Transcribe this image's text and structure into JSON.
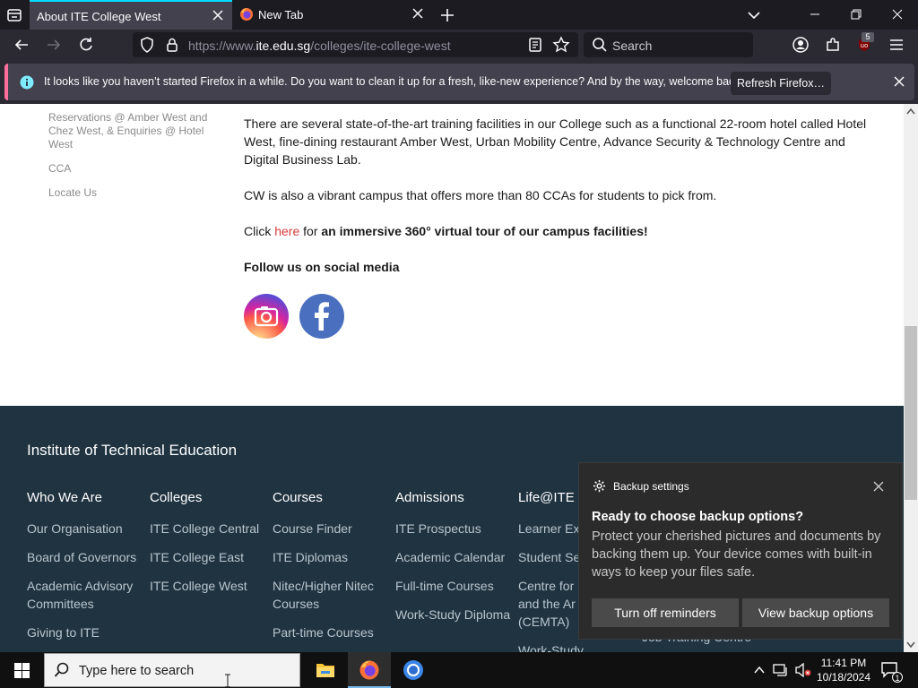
{
  "browser": {
    "tabs": [
      {
        "title": "About ITE College West"
      },
      {
        "title": "New Tab"
      }
    ],
    "url": {
      "prefix": "https://www.",
      "host": "ite.edu.sg",
      "path": "/colleges/ite-college-west"
    },
    "search_placeholder": "Search",
    "extension_badge": "5",
    "notification": {
      "text": "It looks like you haven’t started Firefox in a while. Do you want to clean it up for a fresh, like-new experience? And by the way, welcome back!",
      "button": "Refresh Firefox…"
    }
  },
  "sidebar": {
    "items": [
      {
        "label": "Reservations @ Amber West and Chez West, & Enquiries @ Hotel West"
      },
      {
        "label": "CCA"
      },
      {
        "label": "Locate Us"
      }
    ]
  },
  "main": {
    "paragraph1": "There are several state-of-the-art training facilities in our College such as a functional 22-room hotel called Hotel West, fine-dining restaurant Amber West, Urban Mobility Centre, Advance Security & Technology Centre and Digital Business Lab.",
    "paragraph2": "CW is also a vibrant campus that offers more than 80 CCAs for students to pick from.",
    "tour": {
      "prefix": "Click ",
      "link": "here",
      "middle": " for ",
      "bold": "an immersive 360° virtual tour of our campus facilities!"
    },
    "social_heading": "Follow us on social media"
  },
  "footer": {
    "title": "Institute of Technical Education",
    "columns": [
      {
        "heading": "Who We Are",
        "items": [
          "Our Organisation",
          "Board of Governors",
          "Academic Advisory Committees",
          "Giving to ITE"
        ]
      },
      {
        "heading": "Colleges",
        "items": [
          "ITE College Central",
          "ITE College East",
          "ITE College West"
        ]
      },
      {
        "heading": "Courses",
        "items": [
          "Course Finder",
          "ITE Diplomas",
          "Nitec/Higher Nitec Courses",
          "Part-time Courses"
        ]
      },
      {
        "heading": "Admissions",
        "items": [
          "ITE Prospectus",
          "Academic Calendar",
          "Full-time Courses",
          "Work-Study Diploma"
        ]
      },
      {
        "heading": "Life@ITE",
        "items": [
          "Learner Ex",
          "Student Se",
          "Centre for and the Ar (CEMTA)",
          "Work-Study"
        ]
      }
    ],
    "extra_item": "Job Training Centre"
  },
  "toast": {
    "app_name": "Backup settings",
    "title": "Ready to choose backup options?",
    "body": "Protect your cherished pictures and documents by backing them up. Your device comes with built-in ways to keep your files safe.",
    "button_primary": "Turn off reminders",
    "button_secondary": "View backup options"
  },
  "taskbar": {
    "search_placeholder": "Type here to search",
    "time": "11:41 PM",
    "date": "10/18/2024",
    "notification_count": "1"
  },
  "colors": {
    "accent": "#00ddff",
    "footer_bg": "#1f3340",
    "link": "#d93c3c"
  }
}
